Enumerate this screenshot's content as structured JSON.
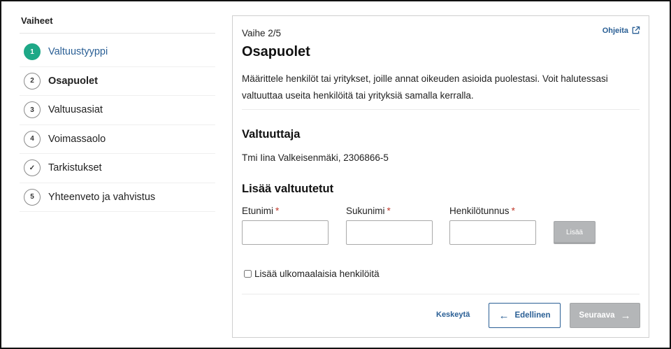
{
  "sidebar": {
    "heading": "Vaiheet",
    "steps": [
      {
        "marker": "1",
        "label": "Valtuustyyppi"
      },
      {
        "marker": "2",
        "label": "Osapuolet"
      },
      {
        "marker": "3",
        "label": "Valtuusasiat"
      },
      {
        "marker": "4",
        "label": "Voimassaolo"
      },
      {
        "marker": "✓",
        "label": "Tarkistukset"
      },
      {
        "marker": "5",
        "label": "Yhteenveto ja vahvistus"
      }
    ]
  },
  "main": {
    "step_indicator": "Vaihe 2/5",
    "help_link": "Ohjeita",
    "title": "Osapuolet",
    "intro": "Määrittele henkilöt tai yritykset, joille annat oikeuden asioida puolestasi. Voit halutessasi valtuuttaa useita henkilöitä tai yrityksiä samalla kerralla.",
    "authorizer": {
      "heading": "Valtuuttaja",
      "value": "Tmi Iina Valkeisenmäki, 2306866-5"
    },
    "add_authorized": {
      "heading": "Lisää valtuutetut",
      "fields": {
        "first_name": {
          "label": "Etunimi",
          "value": ""
        },
        "last_name": {
          "label": "Sukunimi",
          "value": ""
        },
        "personal_id": {
          "label": "Henkilötunnus",
          "value": ""
        }
      },
      "required_marker": "*",
      "add_button": "Lisää",
      "foreign_checkbox": {
        "label": "Lisää ulkomaalaisia henkilöitä",
        "checked": false
      }
    },
    "footer": {
      "cancel": "Keskeytä",
      "previous": "Edellinen",
      "next": "Seuraava"
    }
  },
  "colors": {
    "accent": "#2a5f95",
    "active_step": "#1ea887",
    "disabled_button": "#b4b6b8",
    "required": "#c0392b"
  },
  "icons": {
    "help": "external-link-icon",
    "previous": "arrow-left-icon",
    "next": "arrow-right-icon"
  }
}
